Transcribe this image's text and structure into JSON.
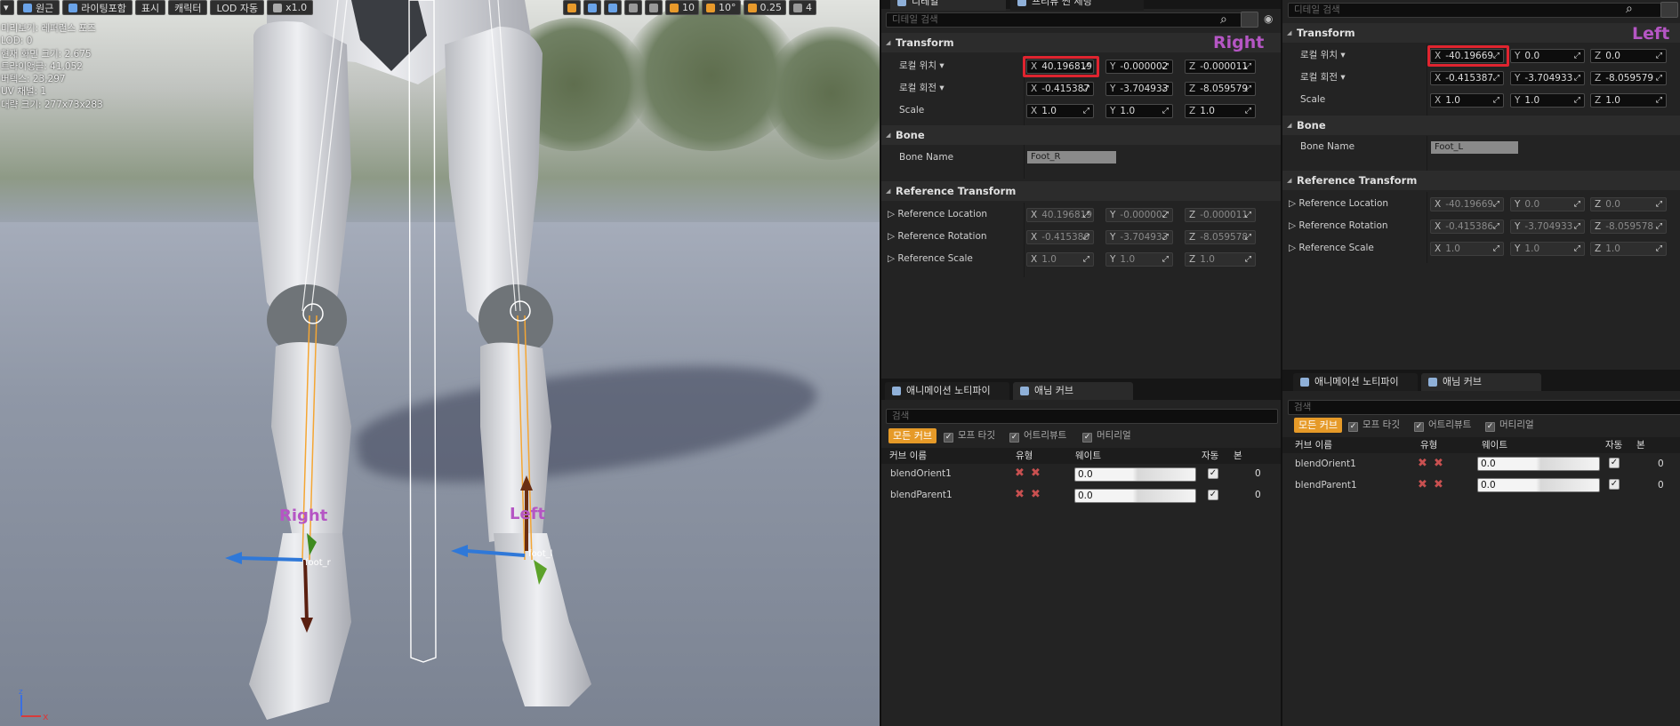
{
  "viewport": {
    "toolbar": [
      {
        "label": "원근",
        "icon": "perspective-icon"
      },
      {
        "label": "라이팅포함",
        "icon": "lit-icon"
      },
      {
        "label": "표시"
      },
      {
        "label": "캐릭터"
      },
      {
        "label": "LOD 자동"
      },
      {
        "label": "x1.0",
        "icon": "speed-icon"
      }
    ],
    "right_toolbar": [
      "10",
      "10°",
      "0.25",
      "4"
    ],
    "stats": [
      "미리보기: 레퍼런스 포즈",
      "LOD: 0",
      "현재 화면 크기: 2.675",
      "트라이앵글: 41,052",
      "버텍스: 23,297",
      "UV 채널: 1",
      "대략 크기: 277x73x283"
    ],
    "bone_label_right": "Right",
    "bone_label_left": "Left",
    "foot_r": "foot_r",
    "foot_l": "foot_l",
    "axis_x": "x",
    "axis_z": "z"
  },
  "right_panel": {
    "tab_partial": [
      "디테일",
      "프리뷰 씬 세팅"
    ],
    "search_placeholder": "디테일 검색",
    "side_label": "Right",
    "transform": {
      "title": "Transform",
      "location_label": "로컬 위치 ▾",
      "location": [
        "40.196819",
        "-0.000002",
        "-0.000011"
      ],
      "rotation_label": "로컬 회전 ▾",
      "rotation": [
        "-0.415387",
        "-3.704933",
        "-8.059579"
      ],
      "scale_label": "Scale",
      "scale": [
        "1.0",
        "1.0",
        "1.0"
      ]
    },
    "bone": {
      "title": "Bone",
      "name_label": "Bone Name",
      "name": "Foot_R"
    },
    "reference": {
      "title": "Reference Transform",
      "location_label": "Reference Location",
      "location": [
        "40.196819",
        "-0.000002",
        "-0.000011"
      ],
      "rotation_label": "Reference Rotation",
      "rotation": [
        "-0.415386",
        "-3.704933",
        "-8.059578"
      ],
      "scale_label": "Reference Scale",
      "scale": [
        "1.0",
        "1.0",
        "1.0"
      ]
    },
    "tabs": [
      "애니메이션 노티파이",
      "애님 커브"
    ],
    "curve_search": "검색",
    "filters": {
      "all": "모든 커브",
      "morph": "모프 타깃",
      "attr": "어트리뷰트",
      "material": "머티리얼"
    },
    "columns": {
      "name": "커브 이름",
      "type": "유형",
      "weight": "웨이트",
      "auto": "자동",
      "bone": "본"
    },
    "curves": [
      {
        "name": "blendOrient1",
        "weight": "0.0",
        "bone": "0"
      },
      {
        "name": "blendParent1",
        "weight": "0.0",
        "bone": "0"
      }
    ]
  },
  "left_panel": {
    "search_placeholder": "디테일 검색",
    "side_label": "Left",
    "transform": {
      "title": "Transform",
      "location_label": "로컬 위치 ▾",
      "location": [
        "-40.19669",
        "0.0",
        "0.0"
      ],
      "rotation_label": "로컬 회전 ▾",
      "rotation": [
        "-0.415387",
        "-3.704933",
        "-8.059579"
      ],
      "scale_label": "Scale",
      "scale": [
        "1.0",
        "1.0",
        "1.0"
      ]
    },
    "bone": {
      "title": "Bone",
      "name_label": "Bone Name",
      "name": "Foot_L"
    },
    "reference": {
      "title": "Reference Transform",
      "location_label": "Reference Location",
      "location": [
        "-40.19669",
        "0.0",
        "0.0"
      ],
      "rotation_label": "Reference Rotation",
      "rotation": [
        "-0.415386",
        "-3.704933",
        "-8.059578"
      ],
      "scale_label": "Reference Scale",
      "scale": [
        "1.0",
        "1.0",
        "1.0"
      ]
    },
    "tabs": [
      "애니메이션 노티파이",
      "애님 커브"
    ],
    "curve_search": "검색",
    "filters": {
      "all": "모든 커브",
      "morph": "모프 타깃",
      "attr": "어트리뷰트",
      "material": "머티리얼"
    },
    "columns": {
      "name": "커브 이름",
      "type": "유형",
      "weight": "웨이트",
      "auto": "자동",
      "bone": "본"
    },
    "curves": [
      {
        "name": "blendOrient1",
        "weight": "0.0",
        "bone": "0"
      },
      {
        "name": "blendParent1",
        "weight": "0.0",
        "bone": "0"
      }
    ]
  },
  "axes": [
    "X",
    "Y",
    "Z"
  ],
  "colors": {
    "highlight": "#e0242f",
    "label": "#b556c4",
    "accent": "#e69a28"
  }
}
